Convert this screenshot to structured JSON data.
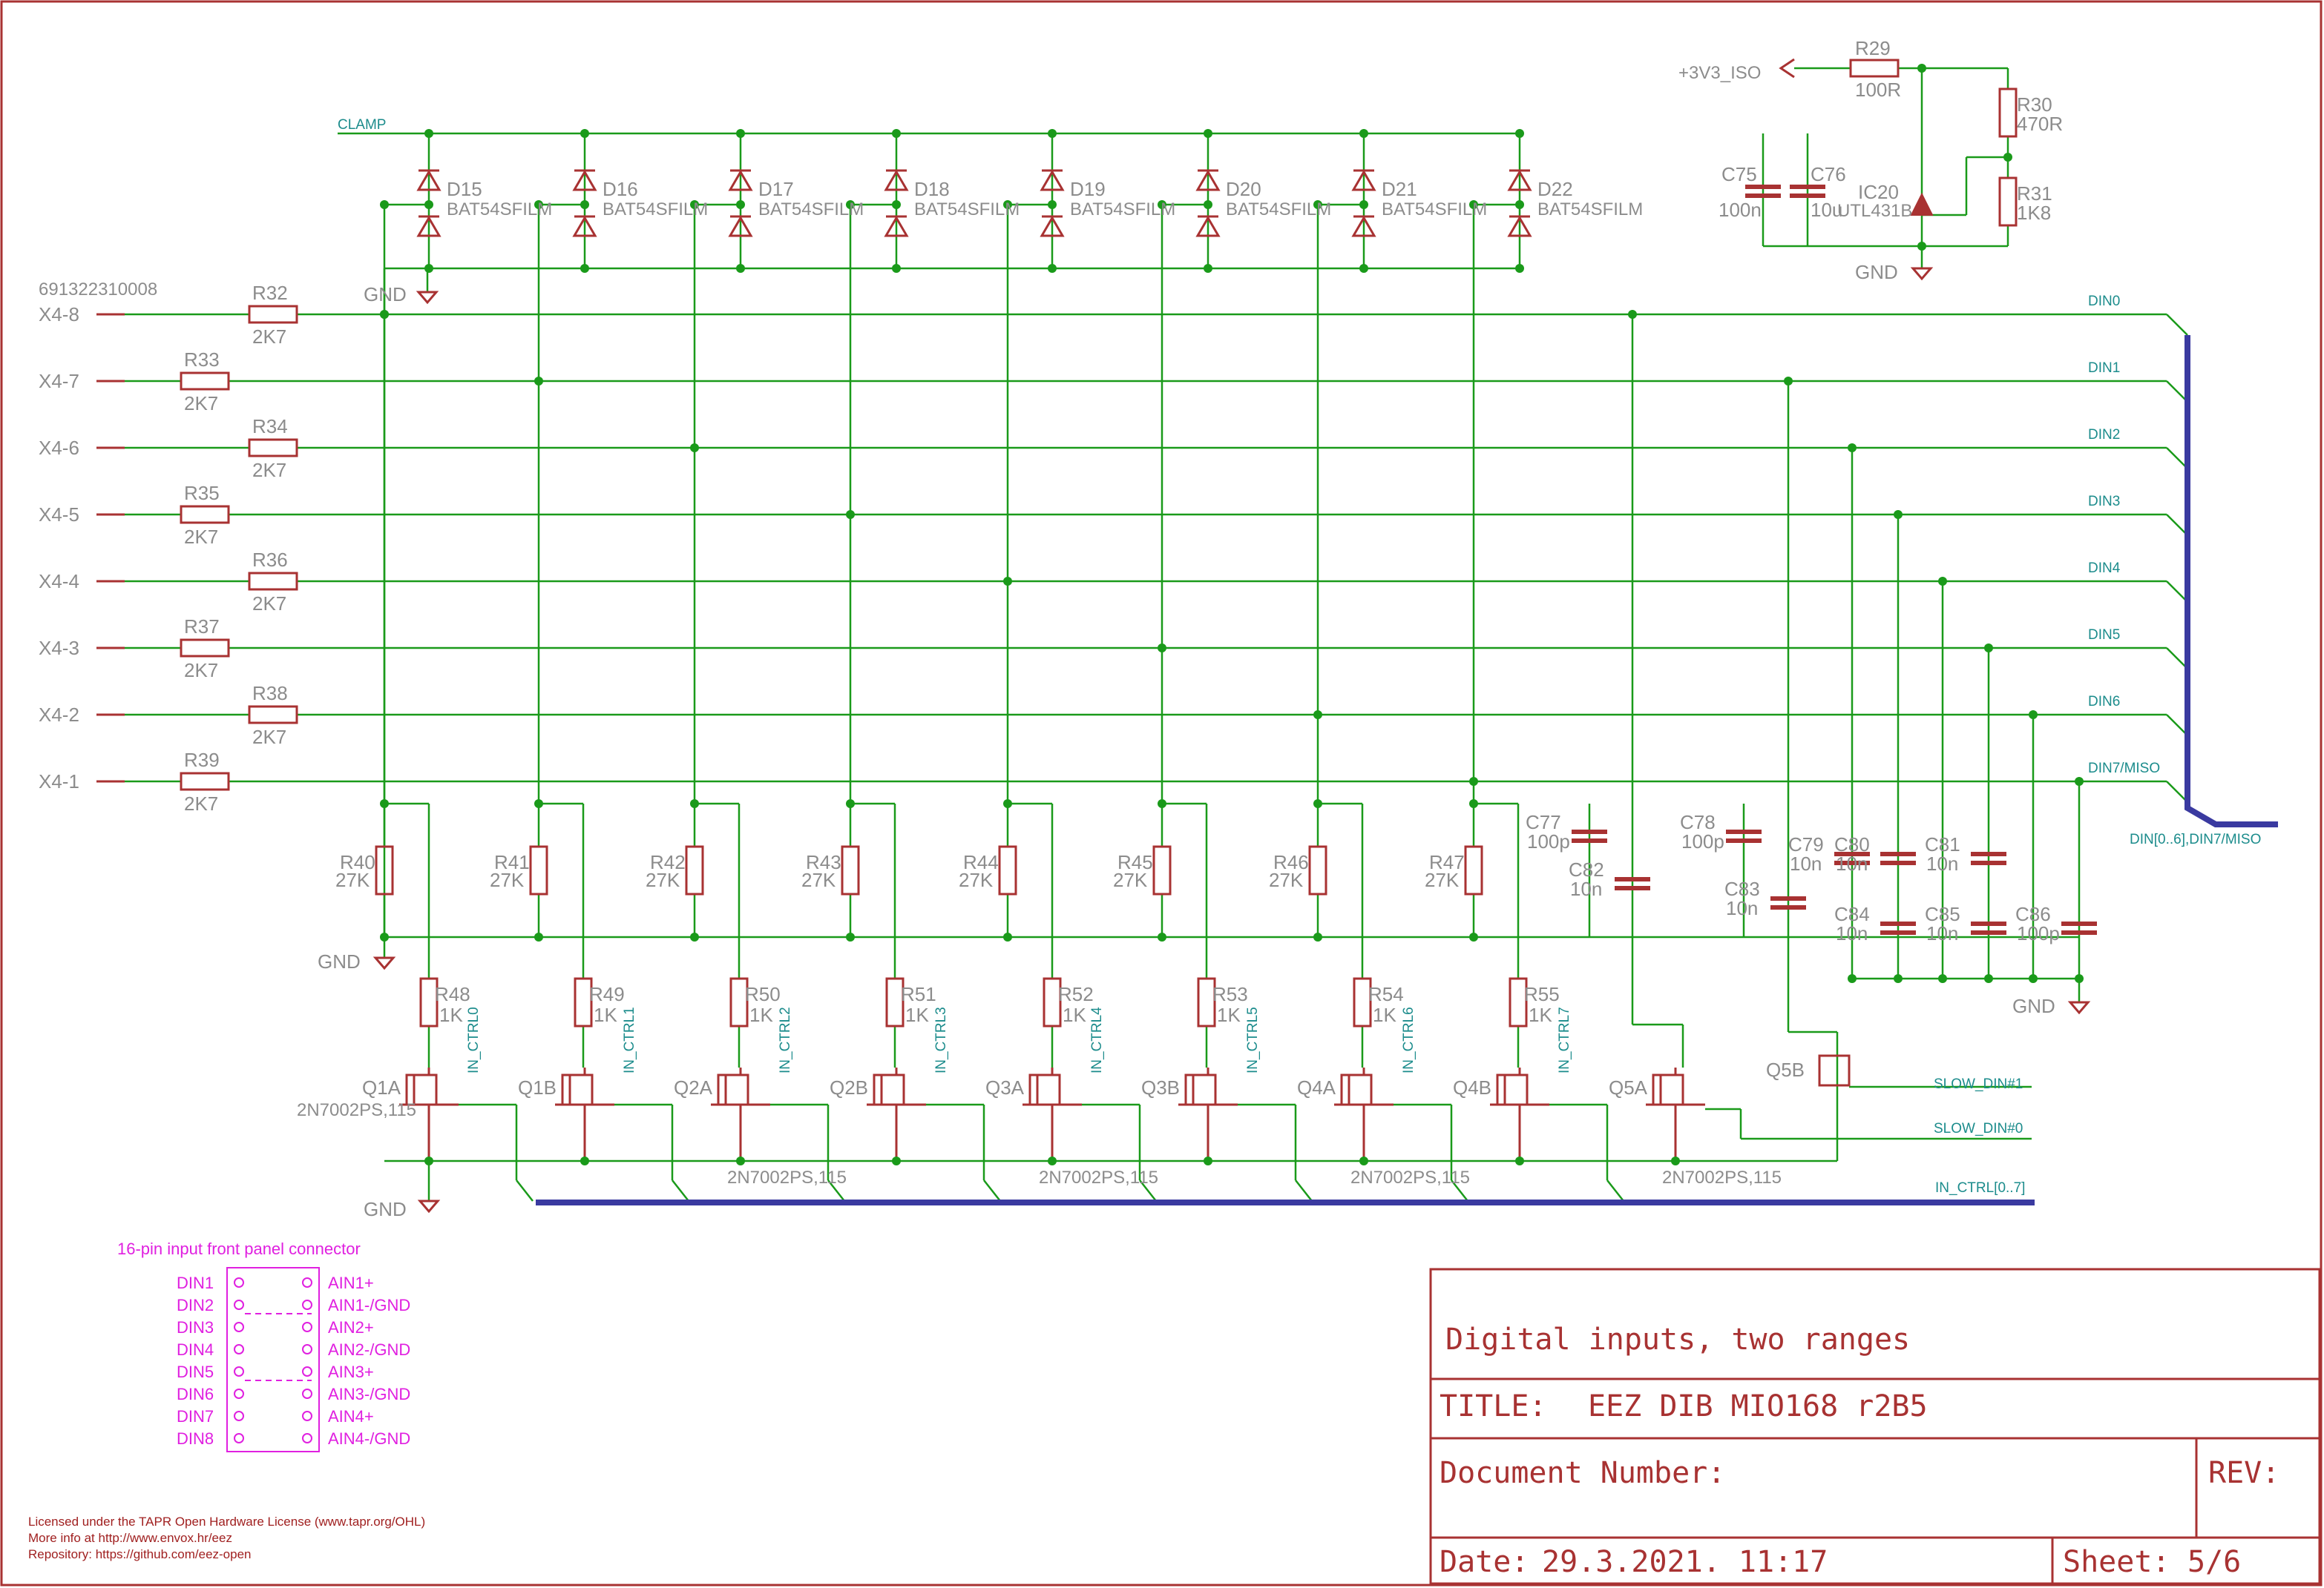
{
  "connector": {
    "part_number": "691322310008",
    "pins": [
      {
        "pin": "X4-8",
        "res": "R32",
        "val": "2K7"
      },
      {
        "pin": "X4-7",
        "res": "R33",
        "val": "2K7"
      },
      {
        "pin": "X4-6",
        "res": "R34",
        "val": "2K7"
      },
      {
        "pin": "X4-5",
        "res": "R35",
        "val": "2K7"
      },
      {
        "pin": "X4-4",
        "res": "R36",
        "val": "2K7"
      },
      {
        "pin": "X4-3",
        "res": "R37",
        "val": "2K7"
      },
      {
        "pin": "X4-2",
        "res": "R38",
        "val": "2K7"
      },
      {
        "pin": "X4-1",
        "res": "R39",
        "val": "2K7"
      }
    ]
  },
  "nets": {
    "clamp": "CLAMP",
    "gnd": "GND",
    "v33": "+3V3_ISO",
    "din": [
      "DIN0",
      "DIN1",
      "DIN2",
      "DIN3",
      "DIN4",
      "DIN5",
      "DIN6",
      "DIN7/MISO"
    ],
    "din_bus": "DIN[0..6],DIN7/MISO",
    "in_ctrl_bus": "IN_CTRL[0..7]",
    "slow1": "SLOW_DIN#1",
    "slow0": "SLOW_DIN#0",
    "in_ctrl": [
      "IN_CTRL0",
      "IN_CTRL1",
      "IN_CTRL2",
      "IN_CTRL3",
      "IN_CTRL4",
      "IN_CTRL5",
      "IN_CTRL6",
      "IN_CTRL7"
    ]
  },
  "diodes": {
    "refs": [
      "D15",
      "D16",
      "D17",
      "D18",
      "D19",
      "D20",
      "D21",
      "D22"
    ],
    "part": "BAT54SFILM"
  },
  "pulldowns": {
    "refs": [
      "R40",
      "R41",
      "R42",
      "R43",
      "R44",
      "R45",
      "R46",
      "R47"
    ],
    "val": "27K"
  },
  "gate_res": {
    "refs": [
      "R48",
      "R49",
      "R50",
      "R51",
      "R52",
      "R53",
      "R54",
      "R55"
    ],
    "val": "1K"
  },
  "fets": {
    "refs": [
      "Q1A",
      "Q1B",
      "Q2A",
      "Q2B",
      "Q3A",
      "Q3B",
      "Q4A",
      "Q4B",
      "Q5A"
    ],
    "part": "2N7002PS,115",
    "q5b": "Q5B"
  },
  "reference": {
    "r29": "R29",
    "r29v": "100R",
    "r30": "R30",
    "r30v": "470R",
    "r31": "R31",
    "r31v": "1K8",
    "c75": "C75",
    "c75v": "100n",
    "c76": "C76",
    "c76v": "10u",
    "ic20": "IC20",
    "ic20p": "UTL431B"
  },
  "caps": [
    {
      "ref": "C77",
      "val": "100p"
    },
    {
      "ref": "C82",
      "val": "10n"
    },
    {
      "ref": "C78",
      "val": "100p"
    },
    {
      "ref": "C83",
      "val": "10n"
    },
    {
      "ref": "C79",
      "val": "10n"
    },
    {
      "ref": "C80",
      "val": "10n"
    },
    {
      "ref": "C81",
      "val": "10n"
    },
    {
      "ref": "C84",
      "val": "10n"
    },
    {
      "ref": "C85",
      "val": "10n"
    },
    {
      "ref": "C86",
      "val": "100p"
    }
  ],
  "panel": {
    "title": "16-pin input front panel connector",
    "left": [
      "DIN1",
      "DIN2",
      "DIN3",
      "DIN4",
      "DIN5",
      "DIN6",
      "DIN7",
      "DIN8"
    ],
    "right": [
      "AIN1+",
      "AIN1-/GND",
      "AIN2+",
      "AIN2-/GND",
      "AIN3+",
      "AIN3-/GND",
      "AIN4+",
      "AIN4-/GND"
    ]
  },
  "license": [
    "Licensed under the TAPR Open Hardware License (www.tapr.org/OHL)",
    "More info at http://www.envox.hr/eez",
    "Repository: https://github.com/eez-open"
  ],
  "title_block": {
    "heading": "Digital inputs, two ranges",
    "title_label": "TITLE:",
    "title": "EEZ DIB MIO168 r2B5",
    "doc_label": "Document Number:",
    "rev_label": "REV:",
    "date_label": "Date:",
    "date": "29.3.2021. 11:17",
    "sheet_label": "Sheet:",
    "sheet": "5/6"
  },
  "colors": {
    "wire": "#1a9a1a",
    "part": "#a83232",
    "bus": "#3a3aa0",
    "net": "#1c8c8c",
    "frame": "#a83232",
    "panel": "#e020e0"
  }
}
